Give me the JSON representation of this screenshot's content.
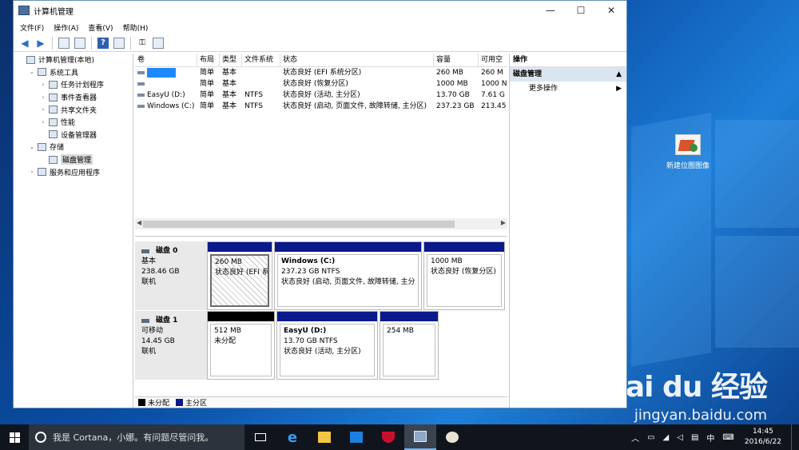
{
  "window": {
    "title": "计算机管理",
    "controls": {
      "minimize": "—",
      "maximize": "☐",
      "close": "✕"
    }
  },
  "menu": [
    "文件(F)",
    "操作(A)",
    "查看(V)",
    "帮助(H)"
  ],
  "tree": [
    {
      "label": "计算机管理(本地)",
      "level": 0,
      "expander": ""
    },
    {
      "label": "系统工具",
      "level": 1,
      "expander": "⌄"
    },
    {
      "label": "任务计划程序",
      "level": 2,
      "expander": "›"
    },
    {
      "label": "事件查看器",
      "level": 2,
      "expander": "›"
    },
    {
      "label": "共享文件夹",
      "level": 2,
      "expander": "›"
    },
    {
      "label": "性能",
      "level": 2,
      "expander": "›"
    },
    {
      "label": "设备管理器",
      "level": 2,
      "expander": ""
    },
    {
      "label": "存储",
      "level": 1,
      "expander": "⌄"
    },
    {
      "label": "磁盘管理",
      "level": 2,
      "expander": "",
      "selected": true
    },
    {
      "label": "服务和应用程序",
      "level": 1,
      "expander": "›"
    }
  ],
  "volumes": {
    "columns": [
      "卷",
      "布局",
      "类型",
      "文件系统",
      "状态",
      "容量",
      "可用空"
    ],
    "rows": [
      [
        "",
        "简单",
        "基本",
        "",
        "状态良好 (EFI 系统分区)",
        "260 MB",
        "260 M"
      ],
      [
        "",
        "简单",
        "基本",
        "",
        "状态良好 (恢复分区)",
        "1000 MB",
        "1000 N"
      ],
      [
        "EasyU (D:)",
        "简单",
        "基本",
        "NTFS",
        "状态良好 (活动, 主分区)",
        "13.70 GB",
        "7.61 G"
      ],
      [
        "Windows (C:)",
        "简单",
        "基本",
        "NTFS",
        "状态良好 (启动, 页面文件, 故障转储, 主分区)",
        "237.23 GB",
        "213.45"
      ]
    ]
  },
  "disks": [
    {
      "name": "磁盘 0",
      "type": "基本",
      "size": "238.46 GB",
      "status": "联机",
      "partitions": [
        {
          "title": "",
          "size": "260 MB",
          "status": "状态良好 (EFI 系",
          "bar": "#0a1a8a",
          "hatch": true
        },
        {
          "title": "Windows  (C:)",
          "size": "237.23 GB NTFS",
          "status": "状态良好 (启动, 页面文件, 故障转储, 主分",
          "bar": "#0a1a8a"
        },
        {
          "title": "",
          "size": "1000 MB",
          "status": "状态良好 (恢复分区)",
          "bar": "#0a1a8a"
        }
      ]
    },
    {
      "name": "磁盘 1",
      "type": "可移动",
      "size": "14.45 GB",
      "status": "联机",
      "partitions": [
        {
          "title": "",
          "size": "512 MB",
          "status": "未分配",
          "bar": "#000000"
        },
        {
          "title": "EasyU  (D:)",
          "size": "13.70 GB NTFS",
          "status": "状态良好 (活动, 主分区)",
          "bar": "#0a1a8a"
        },
        {
          "title": "",
          "size": "254 MB",
          "status": "",
          "bar": "#0a1a8a"
        }
      ]
    }
  ],
  "legend": [
    {
      "label": "未分配",
      "color": "#000000"
    },
    {
      "label": "主分区",
      "color": "#0a1a8a"
    }
  ],
  "actions": {
    "header": "操作",
    "section": "磁盘管理",
    "item": "更多操作"
  },
  "desktop": {
    "icon_label": "新建位图图像"
  },
  "taskbar": {
    "search_placeholder": "我是 Cortana，小娜。有问题尽管问我。",
    "time": "14:45",
    "date": "2016/6/22",
    "ime": "中"
  },
  "watermark": {
    "brand": "Bai du 经验",
    "url": "jingyan.baidu.com"
  }
}
